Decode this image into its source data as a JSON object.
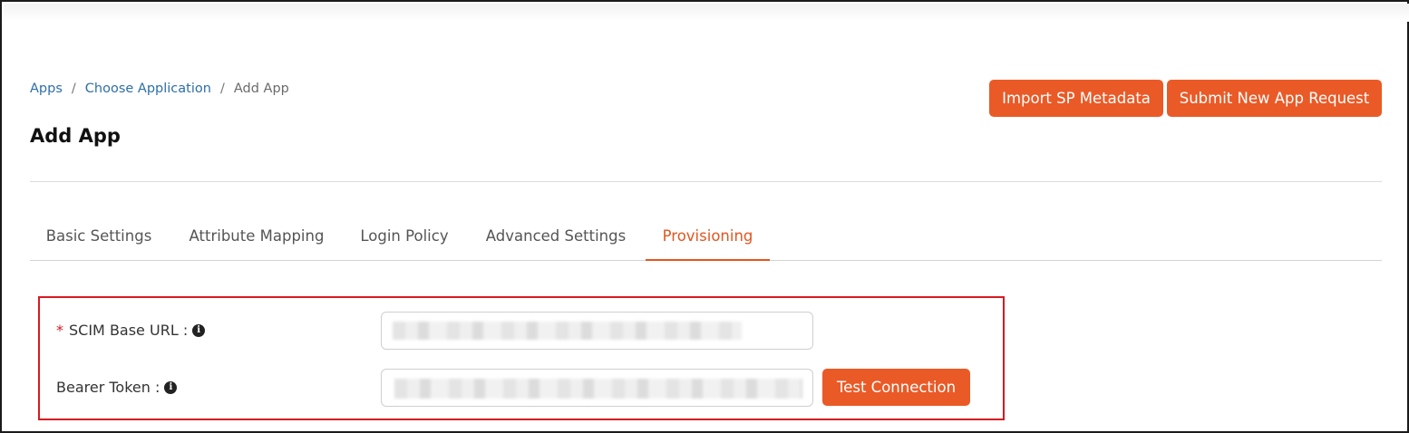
{
  "breadcrumb": {
    "items": [
      "Apps",
      "Choose Application",
      "Add App"
    ],
    "separator": "/"
  },
  "page_title": "Add App",
  "header_actions": {
    "import_label": "Import SP Metadata",
    "submit_label": "Submit New App Request"
  },
  "tabs": [
    {
      "label": "Basic Settings",
      "active": false
    },
    {
      "label": "Attribute Mapping",
      "active": false
    },
    {
      "label": "Login Policy",
      "active": false
    },
    {
      "label": "Advanced Settings",
      "active": false
    },
    {
      "label": "Provisioning",
      "active": true
    }
  ],
  "provisioning": {
    "scim_base_url": {
      "required_mark": "*",
      "label": "SCIM Base URL :",
      "icon": "info-circle-icon"
    },
    "bearer_token": {
      "label": "Bearer Token :",
      "icon": "info-circle-icon"
    },
    "test_connection_label": "Test Connection"
  },
  "colors": {
    "accent": "#ea5a27",
    "link": "#2d6fa8",
    "highlight": "#d71920"
  }
}
